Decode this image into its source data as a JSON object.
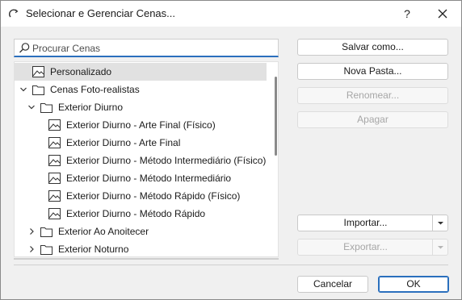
{
  "window": {
    "title": "Selecionar e Gerenciar Cenas...",
    "help_label": "?"
  },
  "search": {
    "placeholder": "Procurar Cenas",
    "value": ""
  },
  "tree": {
    "items": [
      {
        "label": "Personalizado",
        "icon": "scene-image-icon",
        "selected": true
      },
      {
        "label": "Cenas Foto-realistas",
        "icon": "folder-icon",
        "expanded": true
      },
      {
        "label": "Exterior Diurno",
        "icon": "folder-icon",
        "expanded": true
      },
      {
        "label": "Exterior Diurno - Arte Final (Físico)",
        "icon": "scene-image-icon"
      },
      {
        "label": "Exterior Diurno - Arte Final",
        "icon": "scene-image-icon"
      },
      {
        "label": "Exterior Diurno - Método Intermediário (Físico)",
        "icon": "scene-image-icon"
      },
      {
        "label": "Exterior Diurno - Método Intermediário",
        "icon": "scene-image-icon"
      },
      {
        "label": "Exterior Diurno - Método Rápido (Físico)",
        "icon": "scene-image-icon"
      },
      {
        "label": "Exterior Diurno - Método Rápido",
        "icon": "scene-image-icon"
      },
      {
        "label": "Exterior Ao Anoitecer",
        "icon": "folder-icon",
        "expanded": false
      },
      {
        "label": "Exterior Noturno",
        "icon": "folder-icon",
        "expanded": false
      }
    ]
  },
  "actions": {
    "save_as": "Salvar como...",
    "new_folder": "Nova Pasta...",
    "rename": "Renomear...",
    "delete": "Apagar",
    "import": "Importar...",
    "export": "Exportar..."
  },
  "footer": {
    "cancel": "Cancelar",
    "ok": "OK"
  },
  "colors": {
    "accent": "#2a6fbd",
    "selected_row": "#e1e1e1",
    "disabled_text": "#a6a6a6"
  }
}
